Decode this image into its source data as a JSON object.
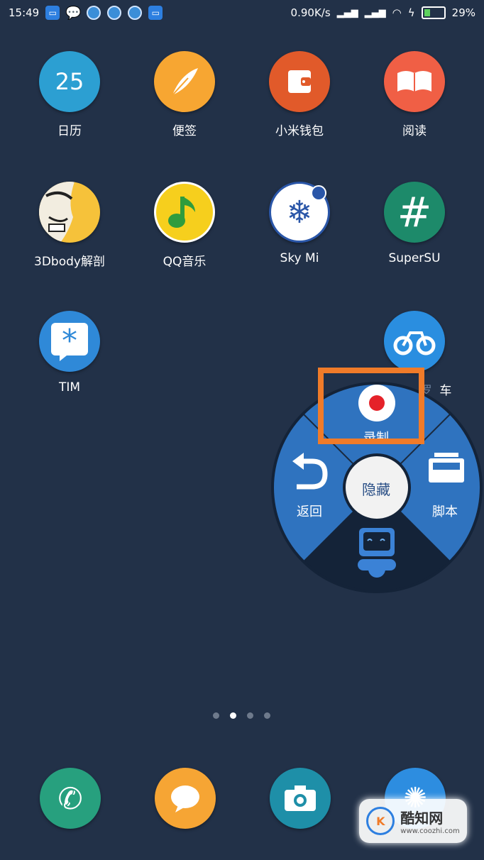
{
  "status_bar": {
    "time": "15:49",
    "network_speed": "0.90K/s",
    "battery_percent": "29%",
    "icons": [
      "desktop-icon",
      "wechat-icon",
      "app-icon",
      "app-icon",
      "app-icon",
      "desktop-icon"
    ]
  },
  "apps": [
    {
      "label": "日历",
      "icon": "calendar-icon",
      "number": "25"
    },
    {
      "label": "便签",
      "icon": "feather-icon"
    },
    {
      "label": "小米钱包",
      "icon": "wallet-icon"
    },
    {
      "label": "阅读",
      "icon": "book-icon"
    },
    {
      "label": "3Dbody解剖",
      "icon": "anatomy-icon"
    },
    {
      "label": "QQ音乐",
      "icon": "music-note-icon"
    },
    {
      "label": "Sky Mi",
      "icon": "snowflake-icon"
    },
    {
      "label": "SuperSU",
      "icon": "hash-icon",
      "glyph": "#"
    },
    {
      "label": "TIM",
      "icon": "star-icon"
    },
    {
      "label": "车",
      "icon": "bicycle-icon",
      "prefix": "罗"
    }
  ],
  "radial_menu": {
    "record": "录制",
    "back": "返回",
    "center": "隐藏",
    "script": "脚本"
  },
  "watermark": {
    "brand": "酷知网",
    "url": "www.coozhi.com"
  },
  "colors": {
    "background": "#223148",
    "menu_blue": "#2f73bf",
    "menu_dark": "#1a2a40",
    "highlight": "#f07b29"
  }
}
